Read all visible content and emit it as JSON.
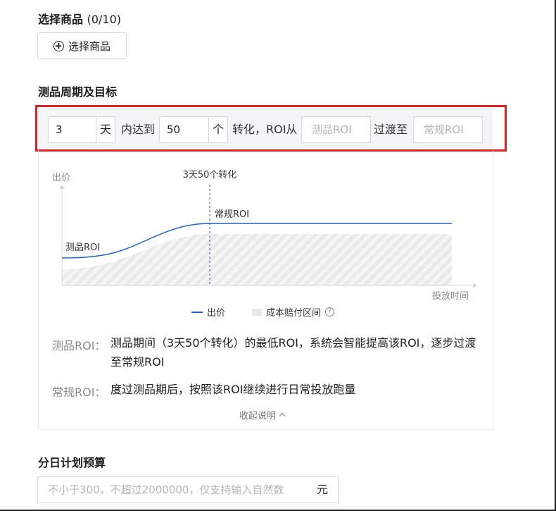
{
  "select_goods": {
    "title": "选择商品",
    "count": "(0/10)",
    "button_label": "选择商品"
  },
  "period": {
    "title": "测品周期及目标",
    "days_value": "3",
    "days_unit": "天",
    "text_within": "内达到",
    "conv_value": "50",
    "conv_unit": "个",
    "text_roi_from": "转化，ROI从",
    "test_roi_placeholder": "测品ROI",
    "text_transition": "过渡至",
    "regular_roi_placeholder": "常规ROI"
  },
  "chart": {
    "y_label": "出价",
    "x_label": "投放时间",
    "marker_label": "3天50个转化",
    "test_roi_label": "测品ROI",
    "regular_roi_label": "常规ROI",
    "legend_bid": "出价",
    "legend_comp": "成本赔付区间",
    "line_color": "#1f5fd6"
  },
  "chart_data": {
    "type": "line",
    "title": "",
    "xlabel": "投放时间",
    "ylabel": "出价",
    "annotations": [
      "3天50个转化",
      "测品ROI",
      "常规ROI"
    ],
    "series": [
      {
        "name": "出价"
      },
      {
        "name": "成本赔付区间"
      }
    ]
  },
  "desc": {
    "test_label": "测品ROI：",
    "test_text": "测品期间（3天50个转化）的最低ROI，系统会智能提高该ROI，逐步过渡至常规ROI",
    "regular_label": "常规ROI：",
    "regular_text": "度过测品期后，按照该ROI继续进行日常投放跑量",
    "collapse_label": "收起说明"
  },
  "budget": {
    "title": "分日计划预算",
    "placeholder": "不小于300，不超过2000000，仅支持输入自然数",
    "unit": "元"
  }
}
